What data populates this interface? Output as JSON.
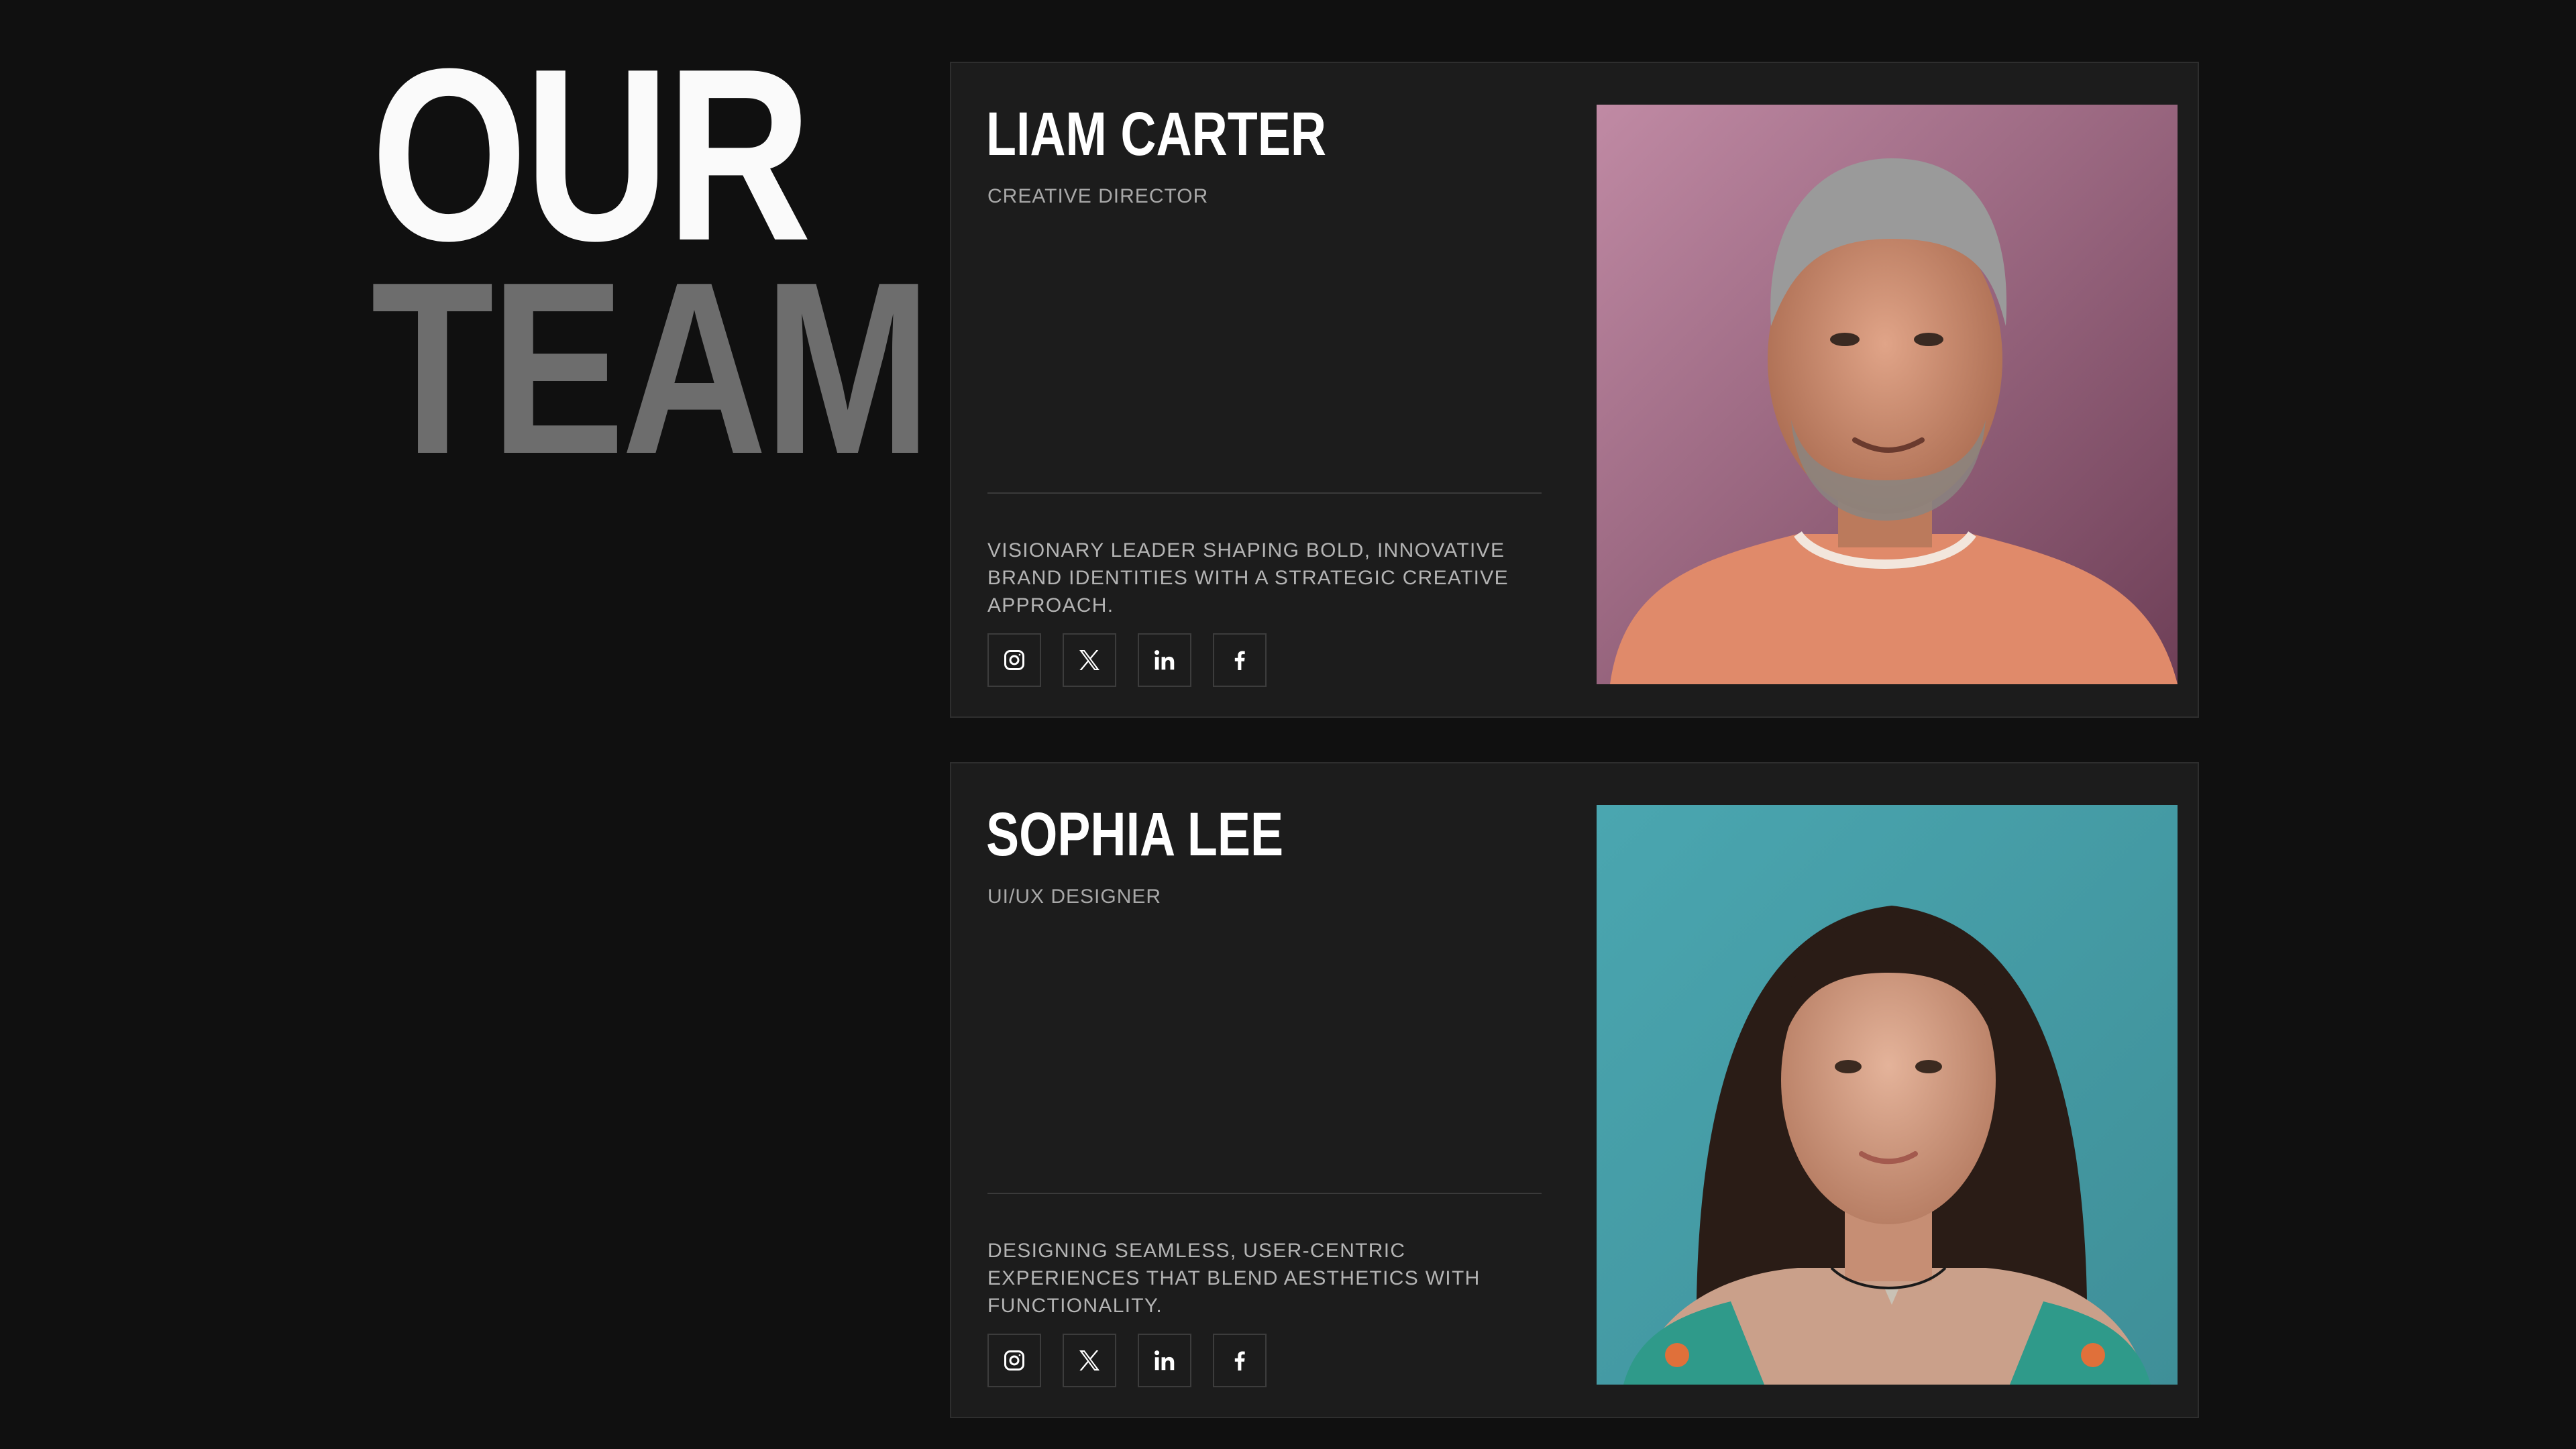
{
  "heading": {
    "line1": "OUR",
    "line2": "TEAM"
  },
  "members": [
    {
      "name": "LIAM CARTER",
      "role": "CREATIVE DIRECTOR",
      "description": "VISIONARY LEADER SHAPING BOLD, INNOVATIVE BRAND IDENTITIES WITH A STRATEGIC CREATIVE APPROACH.",
      "photo_background": "#b07c94"
    },
    {
      "name": "SOPHIA LEE",
      "role": "UI/UX DESIGNER",
      "description": "DESIGNING SEAMLESS, USER-CENTRIC EXPERIENCES THAT BLEND AESTHETICS WITH FUNCTIONALITY.",
      "photo_background": "#4fa3ad"
    }
  ],
  "social_icons": [
    "instagram-icon",
    "x-icon",
    "linkedin-icon",
    "facebook-icon"
  ],
  "colors": {
    "page_background": "#101010",
    "card_background": "#1c1c1c",
    "heading_primary": "#fafafa",
    "heading_secondary": "#6d6d6d",
    "text_muted": "#a8a8a8"
  }
}
